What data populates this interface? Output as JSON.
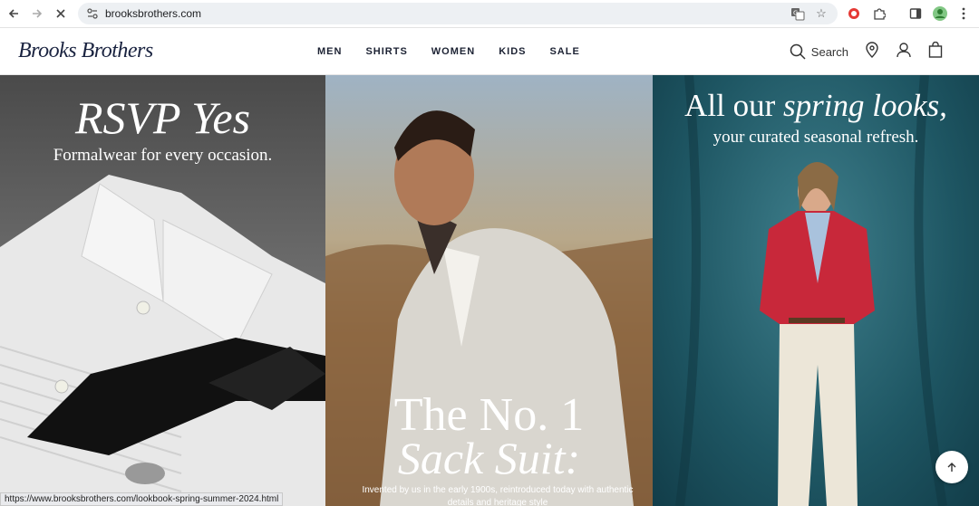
{
  "browser": {
    "url": "brooksbrothers.com",
    "status_url": "https://www.brooksbrothers.com/lookbook-spring-summer-2024.html"
  },
  "site": {
    "logo_text": "Brooks Brothers",
    "nav": [
      "MEN",
      "SHIRTS",
      "WOMEN",
      "KIDS",
      "SALE"
    ],
    "search_label": "Search"
  },
  "panels": {
    "formal": {
      "title": "RSVP Yes",
      "subtitle": "Formalwear for every occasion."
    },
    "suit": {
      "title_line1": "The No. 1",
      "title_line2": "Sack Suit:",
      "body": "Invented by us in the early 1900s, reintroduced today with authentic details and heritage style"
    },
    "spring": {
      "title_plain": "All our ",
      "title_italic": "spring looks,",
      "subtitle": "your curated seasonal refresh."
    }
  },
  "icons": {
    "back": "back-arrow-icon",
    "forward": "forward-arrow-icon",
    "reload": "stop-loading-icon",
    "site_info": "site-info-icon",
    "translate": "translate-icon",
    "bookmark": "star-icon",
    "search": "search-icon",
    "store": "location-pin-icon",
    "account": "user-icon",
    "bag": "shopping-bag-icon"
  },
  "colors": {
    "brand_navy": "#1a2340"
  }
}
